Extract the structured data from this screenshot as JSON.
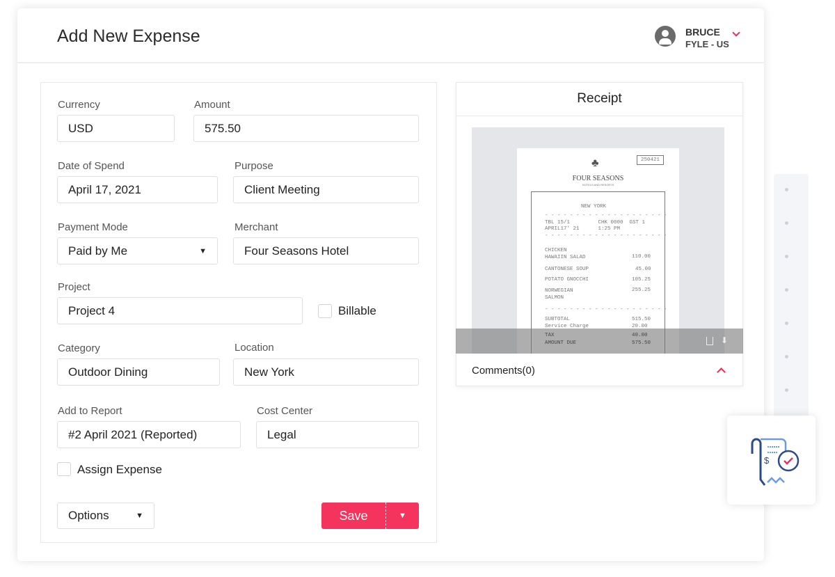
{
  "header": {
    "title": "Add New Expense",
    "user_name": "BRUCE",
    "user_org": "FYLE - US"
  },
  "form": {
    "currency": {
      "label": "Currency",
      "value": "USD"
    },
    "amount": {
      "label": "Amount",
      "value": "575.50"
    },
    "date": {
      "label": "Date of Spend",
      "value": "April 17, 2021"
    },
    "purpose": {
      "label": "Purpose",
      "value": "Client Meeting"
    },
    "payment_mode": {
      "label": "Payment Mode",
      "value": "Paid by Me"
    },
    "merchant": {
      "label": "Merchant",
      "value": "Four Seasons Hotel"
    },
    "project": {
      "label": "Project",
      "value": "Project 4"
    },
    "billable": {
      "label": "Billable",
      "checked": false
    },
    "category": {
      "label": "Category",
      "value": "Outdoor Dining"
    },
    "location": {
      "label": "Location",
      "value": "New York"
    },
    "report": {
      "label": "Add to Report",
      "value": "#2 April 2021 (Reported)"
    },
    "cost_center": {
      "label": "Cost Center",
      "value": "Legal"
    },
    "assign": {
      "label": "Assign Expense",
      "checked": false
    },
    "options_label": "Options",
    "save_label": "Save"
  },
  "receipt": {
    "title": "Receipt",
    "comments_label": "Comments(0)",
    "doc": {
      "number": "250421",
      "brand": "FOUR SEASONS",
      "brand_sub": "HOTELS AND RESORTS",
      "city": "NEW YORK",
      "meta1": "TBL 15/1         CHK 0000  GST 1",
      "meta2": "APRIL17' 21      1:25 PM",
      "items": [
        {
          "name": "CHICKEN\nHAWAIIN SALAD",
          "price": "110.00"
        },
        {
          "name": "CANTONESE SOUP",
          "price": "45.00"
        },
        {
          "name": "POTATO GNOCCHI",
          "price": "105.25"
        },
        {
          "name": "NORWEGIAN\nSALMON",
          "price": "255.25"
        }
      ],
      "totals": [
        {
          "name": "SUBTOTAL",
          "price": "515.50"
        },
        {
          "name": "Service Charge",
          "price": "20.00"
        },
        {
          "name": "TAX",
          "price": "40.00"
        },
        {
          "name": "AMOUNT DUE",
          "price": "575.50"
        }
      ]
    }
  },
  "colors": {
    "accent": "#f5345e",
    "icon_blue": "#2d4a8a"
  }
}
